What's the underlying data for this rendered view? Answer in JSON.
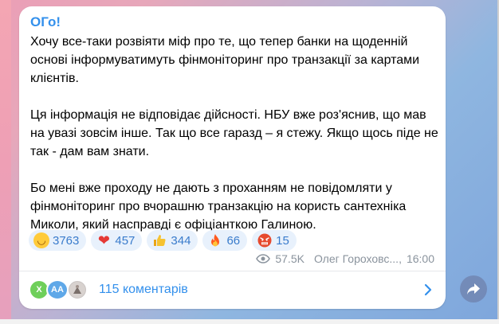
{
  "post": {
    "author": "ОГо!",
    "paragraphs": [
      "Хочу все-таки розвіяти міф про те, що тепер банки на щоденній основі інформуватимуть фінмоніторинг про транзакції за картами клієнтів.",
      "Ця інформація не відповідає дійсності. НБУ вже роз'яснив, що мав на увазі зовсім інше. Так що все гаразд – я стежу. Якщо щось піде не так - дам вам знати.",
      "Бо мені вже проходу не дають з проханням не повідомляти у фінмоніторинг про вчорашню транзакцію на користь сантехніка Миколи, який насправді є офіціанткою Галиною."
    ],
    "reactions": [
      {
        "icon": "laughing-emoji",
        "count": "3763"
      },
      {
        "icon": "heart-emoji",
        "count": "457"
      },
      {
        "icon": "thumbs-up-emoji",
        "count": "344"
      },
      {
        "icon": "fire-emoji",
        "count": "66"
      },
      {
        "icon": "angry-face-emoji",
        "count": "15"
      }
    ],
    "views": "57.5K",
    "signature": "Олег Гороховс...",
    "time": "16:00"
  },
  "comments": {
    "avatars": [
      {
        "initials": "Х",
        "color": "#6fcf5a"
      },
      {
        "initials": "AA",
        "color": "#5fa8e8"
      },
      {
        "initials": "",
        "color": "#c9c4c2"
      }
    ],
    "label": "115 коментарів"
  },
  "colors": {
    "accent": "#3390ec",
    "reaction_bg": "#e8f1fc",
    "meta": "#8a939d"
  }
}
